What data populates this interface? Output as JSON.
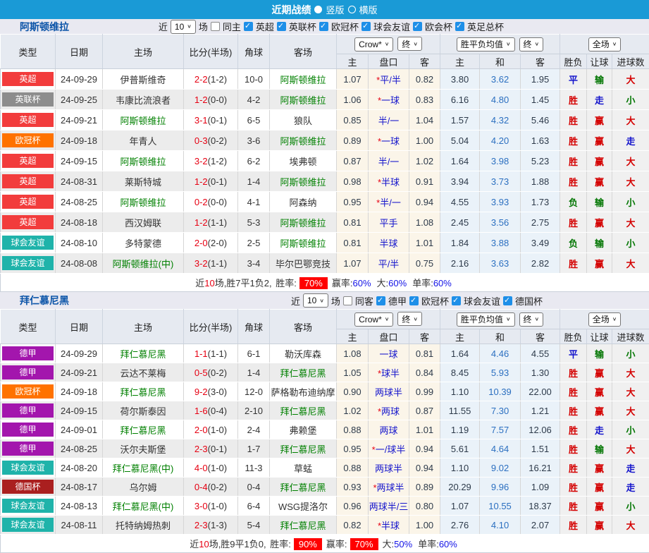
{
  "topbar": {
    "title": "近期战绩",
    "radio_vertical": "竖版",
    "radio_horizontal": "横版"
  },
  "colors": {
    "accent_blue": "#1a9ad6",
    "league": {
      "英超": "#f23c3c",
      "英联杯": "#8d8d8d",
      "欧冠杯": "#ff7200",
      "球会友谊": "#1fb3aa",
      "德甲": "#a316ad",
      "德国杯": "#aa1f1f"
    },
    "result_map": {
      "胜": "#d40000",
      "赢": "#d40000",
      "大": "#d40000",
      "平": "#1414cc",
      "走": "#1414cc",
      "负": "#007500",
      "输": "#007500",
      "小": "#007500"
    }
  },
  "table_header": {
    "type": "类型",
    "date": "日期",
    "home": "主场",
    "score": "比分(半场)",
    "corner": "角球",
    "away": "客场",
    "crow_select": "Crow*",
    "final_select": "终",
    "avg_select": "胜平负均值",
    "final_select2": "终",
    "scope_select": "全场",
    "crow_home": "主",
    "crow_handicap": "盘口",
    "crow_away": "客",
    "avg_home": "主",
    "avg_draw": "和",
    "avg_away": "客",
    "wl": "胜负",
    "handicap_wl": "让球",
    "goals": "进球数"
  },
  "sections": [
    {
      "team": "阿斯顿维拉",
      "filter": {
        "near_label": "近",
        "count": "10",
        "games_label": "场",
        "same_label": "同主",
        "same_checked": false,
        "leagues": [
          "英超",
          "英联杯",
          "欧冠杯",
          "球会友谊",
          "欧会杯",
          "英足总杯"
        ]
      },
      "rows": [
        {
          "league": "英超",
          "date": "24-09-29",
          "home": "伊普斯维奇",
          "home_self": false,
          "score": "2-2",
          "half": "(1-2)",
          "corner": "10-0",
          "away": "阿斯顿维拉",
          "away_self": true,
          "o1": "1.07",
          "handicap_star": "*",
          "handicap": "平/半",
          "o2": "0.82",
          "a1": "3.80",
          "a2": "3.62",
          "a3": "1.95",
          "r1": "平",
          "r2": "输",
          "r3": "大"
        },
        {
          "league": "英联杯",
          "date": "24-09-25",
          "home": "韦康比流浪者",
          "home_self": false,
          "score": "1-2",
          "half": "(0-0)",
          "corner": "4-2",
          "away": "阿斯顿维拉",
          "away_self": true,
          "o1": "1.06",
          "handicap_star": "*",
          "handicap": "一球",
          "o2": "0.83",
          "a1": "6.16",
          "a2": "4.80",
          "a3": "1.45",
          "r1": "胜",
          "r2": "走",
          "r3": "小"
        },
        {
          "league": "英超",
          "date": "24-09-21",
          "home": "阿斯顿维拉",
          "home_self": true,
          "score": "3-1",
          "half": "(0-1)",
          "corner": "6-5",
          "away": "狼队",
          "away_self": false,
          "o1": "0.85",
          "handicap_star": "",
          "handicap": "半/一",
          "o2": "1.04",
          "a1": "1.57",
          "a2": "4.32",
          "a3": "5.46",
          "r1": "胜",
          "r2": "赢",
          "r3": "大"
        },
        {
          "league": "欧冠杯",
          "date": "24-09-18",
          "home": "年青人",
          "home_self": false,
          "score": "0-3",
          "half": "(0-2)",
          "corner": "3-6",
          "away": "阿斯顿维拉",
          "away_self": true,
          "o1": "0.89",
          "handicap_star": "*",
          "handicap": "一球",
          "o2": "1.00",
          "a1": "5.04",
          "a2": "4.20",
          "a3": "1.63",
          "r1": "胜",
          "r2": "赢",
          "r3": "走"
        },
        {
          "league": "英超",
          "date": "24-09-15",
          "home": "阿斯顿维拉",
          "home_self": true,
          "score": "3-2",
          "half": "(1-2)",
          "corner": "6-2",
          "away": "埃弗顿",
          "away_self": false,
          "o1": "0.87",
          "handicap_star": "",
          "handicap": "半/一",
          "o2": "1.02",
          "a1": "1.64",
          "a2": "3.98",
          "a3": "5.23",
          "r1": "胜",
          "r2": "赢",
          "r3": "大"
        },
        {
          "league": "英超",
          "date": "24-08-31",
          "home": "莱斯特城",
          "home_self": false,
          "score": "1-2",
          "half": "(0-1)",
          "corner": "1-4",
          "away": "阿斯顿维拉",
          "away_self": true,
          "o1": "0.98",
          "handicap_star": "*",
          "handicap": "半球",
          "o2": "0.91",
          "a1": "3.94",
          "a2": "3.73",
          "a3": "1.88",
          "r1": "胜",
          "r2": "赢",
          "r3": "大"
        },
        {
          "league": "英超",
          "date": "24-08-25",
          "home": "阿斯顿维拉",
          "home_self": true,
          "score": "0-2",
          "half": "(0-0)",
          "corner": "4-1",
          "away": "阿森纳",
          "away_self": false,
          "o1": "0.95",
          "handicap_star": "*",
          "handicap": "半/一",
          "o2": "0.94",
          "a1": "4.55",
          "a2": "3.93",
          "a3": "1.73",
          "r1": "负",
          "r2": "输",
          "r3": "小"
        },
        {
          "league": "英超",
          "date": "24-08-18",
          "home": "西汉姆联",
          "home_self": false,
          "score": "1-2",
          "half": "(1-1)",
          "corner": "5-3",
          "away": "阿斯顿维拉",
          "away_self": true,
          "o1": "0.81",
          "handicap_star": "",
          "handicap": "平手",
          "o2": "1.08",
          "a1": "2.45",
          "a2": "3.56",
          "a3": "2.75",
          "r1": "胜",
          "r2": "赢",
          "r3": "大"
        },
        {
          "league": "球会友谊",
          "date": "24-08-10",
          "home": "多特蒙德",
          "home_self": false,
          "score": "2-0",
          "half": "(2-0)",
          "corner": "2-5",
          "away": "阿斯顿维拉",
          "away_self": true,
          "o1": "0.81",
          "handicap_star": "",
          "handicap": "半球",
          "o2": "1.01",
          "a1": "1.84",
          "a2": "3.88",
          "a3": "3.49",
          "r1": "负",
          "r2": "输",
          "r3": "小"
        },
        {
          "league": "球会友谊",
          "date": "24-08-08",
          "home": "阿斯顿维拉(中)",
          "home_self": true,
          "score": "3-2",
          "half": "(1-1)",
          "corner": "3-4",
          "away": "毕尔巴鄂竞技",
          "away_self": false,
          "o1": "1.07",
          "handicap_star": "",
          "handicap": "平/半",
          "o2": "0.75",
          "a1": "2.16",
          "a2": "3.63",
          "a3": "2.82",
          "r1": "胜",
          "r2": "赢",
          "r3": "大"
        }
      ],
      "summary": {
        "near": "近",
        "count": "10",
        "record": "场,胜7平1负2, ",
        "stats": [
          {
            "label": "胜率:",
            "value": "70%",
            "badge": true
          },
          {
            "label": "赢率:",
            "value": "60%",
            "badge": false
          },
          {
            "label": "大:",
            "value": "60%",
            "badge": false
          },
          {
            "label": "单率:",
            "value": "60%",
            "badge": false
          }
        ]
      }
    },
    {
      "team": "拜仁慕尼黑",
      "filter": {
        "near_label": "近",
        "count": "10",
        "games_label": "场",
        "same_label": "同客",
        "same_checked": false,
        "leagues": [
          "德甲",
          "欧冠杯",
          "球会友谊",
          "德国杯"
        ]
      },
      "rows": [
        {
          "league": "德甲",
          "date": "24-09-29",
          "home": "拜仁慕尼黑",
          "home_self": true,
          "score": "1-1",
          "half": "(1-1)",
          "corner": "6-1",
          "away": "勒沃库森",
          "away_self": false,
          "o1": "1.08",
          "handicap_star": "",
          "handicap": "一球",
          "o2": "0.81",
          "a1": "1.64",
          "a2": "4.46",
          "a3": "4.55",
          "r1": "平",
          "r2": "输",
          "r3": "小"
        },
        {
          "league": "德甲",
          "date": "24-09-21",
          "home": "云达不莱梅",
          "home_self": false,
          "score": "0-5",
          "half": "(0-2)",
          "corner": "1-4",
          "away": "拜仁慕尼黑",
          "away_self": true,
          "o1": "1.05",
          "handicap_star": "*",
          "handicap": "球半",
          "o2": "0.84",
          "a1": "8.45",
          "a2": "5.93",
          "a3": "1.30",
          "r1": "胜",
          "r2": "赢",
          "r3": "大"
        },
        {
          "league": "欧冠杯",
          "date": "24-09-18",
          "home": "拜仁慕尼黑",
          "home_self": true,
          "score": "9-2",
          "half": "(3-0)",
          "corner": "12-0",
          "away": "萨格勒布迪纳摩",
          "away_self": false,
          "o1": "0.90",
          "handicap_star": "",
          "handicap": "两球半",
          "o2": "0.99",
          "a1": "1.10",
          "a2": "10.39",
          "a3": "22.00",
          "r1": "胜",
          "r2": "赢",
          "r3": "大"
        },
        {
          "league": "德甲",
          "date": "24-09-15",
          "home": "荷尔斯泰因",
          "home_self": false,
          "score": "1-6",
          "half": "(0-4)",
          "corner": "2-10",
          "away": "拜仁慕尼黑",
          "away_self": true,
          "o1": "1.02",
          "handicap_star": "*",
          "handicap": "两球",
          "o2": "0.87",
          "a1": "11.55",
          "a2": "7.30",
          "a3": "1.21",
          "r1": "胜",
          "r2": "赢",
          "r3": "大"
        },
        {
          "league": "德甲",
          "date": "24-09-01",
          "home": "拜仁慕尼黑",
          "home_self": true,
          "score": "2-0",
          "half": "(1-0)",
          "corner": "2-4",
          "away": "弗赖堡",
          "away_self": false,
          "o1": "0.88",
          "handicap_star": "",
          "handicap": "两球",
          "o2": "1.01",
          "a1": "1.19",
          "a2": "7.57",
          "a3": "12.06",
          "r1": "胜",
          "r2": "走",
          "r3": "小"
        },
        {
          "league": "德甲",
          "date": "24-08-25",
          "home": "沃尔夫斯堡",
          "home_self": false,
          "score": "2-3",
          "half": "(0-1)",
          "corner": "1-7",
          "away": "拜仁慕尼黑",
          "away_self": true,
          "o1": "0.95",
          "handicap_star": "*",
          "handicap": "一/球半",
          "o2": "0.94",
          "a1": "5.61",
          "a2": "4.64",
          "a3": "1.51",
          "r1": "胜",
          "r2": "输",
          "r3": "大"
        },
        {
          "league": "球会友谊",
          "date": "24-08-20",
          "home": "拜仁慕尼黑(中)",
          "home_self": true,
          "score": "4-0",
          "half": "(1-0)",
          "corner": "11-3",
          "away": "草蜢",
          "away_self": false,
          "o1": "0.88",
          "handicap_star": "",
          "handicap": "两球半",
          "o2": "0.94",
          "a1": "1.10",
          "a2": "9.02",
          "a3": "16.21",
          "r1": "胜",
          "r2": "赢",
          "r3": "走"
        },
        {
          "league": "德国杯",
          "date": "24-08-17",
          "home": "乌尔姆",
          "home_self": false,
          "score": "0-4",
          "half": "(0-2)",
          "corner": "0-4",
          "away": "拜仁慕尼黑",
          "away_self": true,
          "o1": "0.93",
          "handicap_star": "*",
          "handicap": "两球半",
          "o2": "0.89",
          "a1": "20.29",
          "a2": "9.96",
          "a3": "1.09",
          "r1": "胜",
          "r2": "赢",
          "r3": "走"
        },
        {
          "league": "球会友谊",
          "date": "24-08-13",
          "home": "拜仁慕尼黑(中)",
          "home_self": true,
          "score": "3-0",
          "half": "(1-0)",
          "corner": "6-4",
          "away": "WSG提洛尔",
          "away_self": false,
          "o1": "0.96",
          "handicap_star": "",
          "handicap": "两球半/三",
          "o2": "0.80",
          "a1": "1.07",
          "a2": "10.55",
          "a3": "18.37",
          "r1": "胜",
          "r2": "赢",
          "r3": "小"
        },
        {
          "league": "球会友谊",
          "date": "24-08-11",
          "home": "托特纳姆热刺",
          "home_self": false,
          "score": "2-3",
          "half": "(1-3)",
          "corner": "5-4",
          "away": "拜仁慕尼黑",
          "away_self": true,
          "o1": "0.82",
          "handicap_star": "*",
          "handicap": "半球",
          "o2": "1.00",
          "a1": "2.76",
          "a2": "4.10",
          "a3": "2.07",
          "r1": "胜",
          "r2": "赢",
          "r3": "大"
        }
      ],
      "summary": {
        "near": "近",
        "count": "10",
        "record": "场,胜9平1负0, ",
        "stats": [
          {
            "label": "胜率:",
            "value": "90%",
            "badge": true
          },
          {
            "label": "赢率:",
            "value": "70%",
            "badge": true
          },
          {
            "label": "大:",
            "value": "50%",
            "badge": false
          },
          {
            "label": "单率:",
            "value": "60%",
            "badge": false
          }
        ]
      }
    }
  ]
}
